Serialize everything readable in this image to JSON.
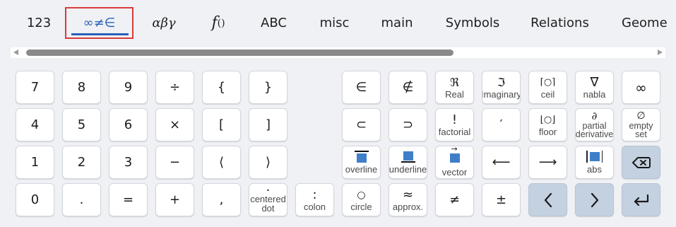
{
  "tabs": [
    {
      "label": "123"
    },
    {
      "label": "∞≠∈",
      "active": true
    },
    {
      "label": "αβγ"
    },
    {
      "label": "f",
      "sub": "()"
    },
    {
      "label": "ABC"
    },
    {
      "label": "misc"
    },
    {
      "label": "main"
    },
    {
      "label": "Symbols"
    },
    {
      "label": "Relations"
    },
    {
      "label": "Geome"
    }
  ],
  "keys": {
    "k7": "7",
    "k8": "8",
    "k9": "9",
    "divide": "÷",
    "lbrace": "{",
    "rbrace": "}",
    "k4": "4",
    "k5": "5",
    "k6": "6",
    "times": "×",
    "lbracket": "[",
    "rbracket": "]",
    "k1": "1",
    "k2": "2",
    "k3": "3",
    "minus": "−",
    "langle": "⟨",
    "rangle": "⟩",
    "k0": "0",
    "dot": ".",
    "equals": "=",
    "plus": "+",
    "comma": ",",
    "centered_dot": {
      "glyph": "·",
      "label_1": "centered",
      "label_2": "dot"
    },
    "colon": {
      "glyph": ":",
      "label": "colon"
    },
    "element_of": "∈",
    "not_element_of": "∉",
    "real": {
      "glyph": "ℜ",
      "label": "Real"
    },
    "imaginary": {
      "glyph": "ℑ",
      "label": "Imaginary"
    },
    "ceil": {
      "glyph": "⌈○⌉",
      "label": "ceil"
    },
    "nabla": {
      "glyph": "∇",
      "label": "nabla"
    },
    "infinity": "∞",
    "subset": "⊂",
    "superset": "⊃",
    "factorial": {
      "glyph": "!",
      "label": "factorial"
    },
    "prime": "′",
    "floor": {
      "glyph": "⌊○⌋",
      "label": "floor"
    },
    "partial": {
      "glyph": "∂",
      "label_1": "partial",
      "label_2": "derivative"
    },
    "empty_set": {
      "glyph": "∅",
      "label_1": "empty",
      "label_2": "set"
    },
    "overline": {
      "label": "overline"
    },
    "underline": {
      "label": "underline"
    },
    "vector": {
      "glyph": "→",
      "label": "vector"
    },
    "left_arrow": "⟵",
    "right_arrow": "⟶",
    "abs": {
      "label": "abs"
    },
    "circle": {
      "glyph": "○",
      "label": "circle"
    },
    "approx": {
      "glyph": "≈",
      "label": "approx."
    },
    "not_equal": "≠",
    "plus_minus": "±"
  },
  "colors": {
    "accent": "#2a62b4",
    "highlight_border": "#d93a3a",
    "placeholder_box": "#3f7fca",
    "action_key": "#c3d1e0"
  },
  "icons": [
    "backspace-icon",
    "chevron-left-icon",
    "chevron-right-icon",
    "enter-icon"
  ]
}
